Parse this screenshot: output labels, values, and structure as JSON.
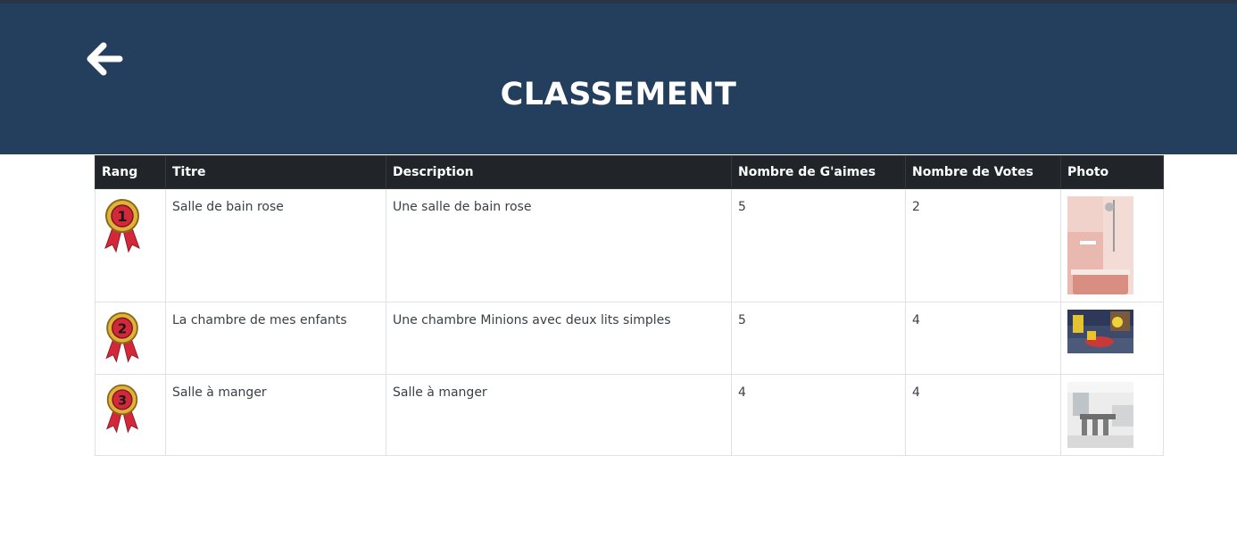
{
  "header": {
    "title": "CLASSEMENT",
    "back_icon": "arrow-left-icon",
    "background_color": "#243f5d"
  },
  "table": {
    "columns": [
      "Rang",
      "Titre",
      "Description",
      "Nombre de G'aimes",
      "Nombre de Votes",
      "Photo"
    ],
    "rows": [
      {
        "rank": "1",
        "medal_icon": "medal-1-icon",
        "title": "Salle de bain rose",
        "description": "Une salle de bain rose",
        "likes": "5",
        "votes": "2",
        "photo_icon": "bathroom-photo"
      },
      {
        "rank": "2",
        "medal_icon": "medal-2-icon",
        "title": "La chambre de mes enfants",
        "description": "Une chambre Minions avec deux lits simples",
        "likes": "5",
        "votes": "4",
        "photo_icon": "kids-bedroom-photo"
      },
      {
        "rank": "3",
        "medal_icon": "medal-3-icon",
        "title": "Salle à manger",
        "description": "Salle à manger",
        "likes": "4",
        "votes": "4",
        "photo_icon": "dining-room-photo"
      }
    ]
  }
}
